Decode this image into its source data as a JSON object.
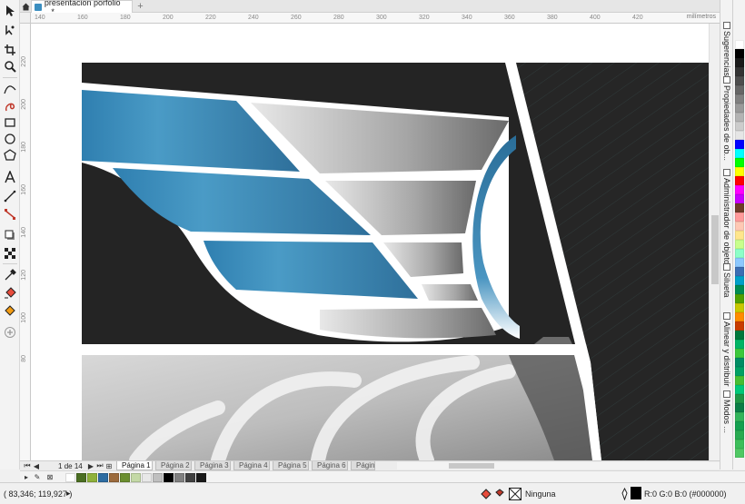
{
  "tabs": {
    "document_title": "presentacion porfolio ...*"
  },
  "ruler": {
    "units": "milímetros",
    "top_ticks": [
      "140",
      "160",
      "180",
      "200",
      "220",
      "240",
      "260",
      "280",
      "300",
      "320",
      "340",
      "360",
      "380",
      "400",
      "420"
    ],
    "left_ticks": [
      "220",
      "200",
      "180",
      "160",
      "140",
      "120",
      "100",
      "80"
    ]
  },
  "dockers": [
    {
      "label": "Sugerencias",
      "icon": "hint-icon"
    },
    {
      "label": "Propiedades de ob...",
      "icon": "properties-icon"
    },
    {
      "label": "Administrador de objetos",
      "icon": "object-manager-icon"
    },
    {
      "label": "Silueta",
      "icon": "contour-icon"
    },
    {
      "label": "Alinear y distribuir",
      "icon": "align-icon"
    },
    {
      "label": "Modos ...",
      "icon": "modes-icon"
    }
  ],
  "page_navigator": {
    "current": "1",
    "of_label": "de",
    "total": "14",
    "pages": [
      "Página 1",
      "Página 2",
      "Página 3",
      "Página 4",
      "Página 5",
      "Página 6",
      "Págin"
    ]
  },
  "palette_colors": [
    "#ffffff",
    "#000000",
    "#1a1a1a",
    "#333333",
    "#4d4d4d",
    "#666666",
    "#808080",
    "#999999",
    "#b3b3b3",
    "#cccccc",
    "#e6e6e6",
    "#0000ff",
    "#00ffff",
    "#00ff00",
    "#ffff00",
    "#ff0000",
    "#ff00ff",
    "#c800ff",
    "#6e3c28",
    "#ff9a9a",
    "#ffc8b4",
    "#ffe68c",
    "#c8ff8c",
    "#8cffc8",
    "#8cc8ff",
    "#3c6eb4",
    "#00a0c8",
    "#008c50",
    "#50a000",
    "#c8c800",
    "#ff8c00",
    "#c83c00",
    "#00783c",
    "#00b464",
    "#3cc83c",
    "#008c64",
    "#00a064",
    "#46be32",
    "#00c878",
    "#1e9646",
    "#0a7d46",
    "#32b45a",
    "#14a050",
    "#28aa50",
    "#3cbe5a",
    "#50c864"
  ],
  "document_palette": [
    "#ffffff",
    "#4a6e22",
    "#8fb13a",
    "#2d6ca1",
    "#9b6a3c",
    "#6b8e2f",
    "#c4d9a6",
    "#e8e8e8",
    "#bfbfbf",
    "#000000",
    "#808080",
    "#404040",
    "#1a1a1a"
  ],
  "status": {
    "coordinates": "( 83,346; 119,927 )",
    "arrow": "▸",
    "fill_label": "Ninguna",
    "outline_label": "R:0 G:0 B:0 (#000000)"
  },
  "colors": {
    "accent_blue": "#3d8dbd",
    "art_dark": "#262626",
    "art_gray": "#a8a8a8"
  }
}
